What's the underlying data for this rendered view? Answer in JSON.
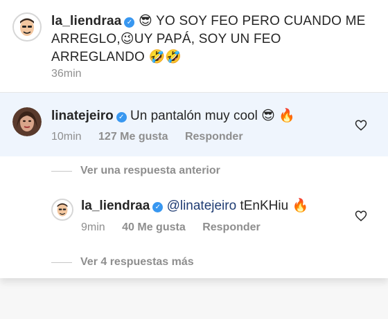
{
  "post": {
    "username": "la_liendraa",
    "caption": "😎 YO SOY FEO PERO CUANDO ME ARREGLO,😉UY PAPÁ, SOY UN FEO ARREGLANDO 🤣🤣",
    "time": "36min"
  },
  "comments": [
    {
      "username": "linatejeiro",
      "text": "Un pantalón muy cool 😎 🔥",
      "time": "10min",
      "likes": "127 Me gusta",
      "reply": "Responder"
    }
  ],
  "thread": {
    "previous_label": "Ver una respuesta anterior",
    "more_label": "Ver 4 respuestas más"
  },
  "reply": {
    "username": "la_liendraa",
    "mention": "@linatejeiro",
    "text": "tEnKHiu 🔥",
    "time": "9min",
    "likes": "40 Me gusta",
    "reply": "Responder"
  },
  "colors": {
    "verified": "#3897f0",
    "highlight": "#eff5fd",
    "muted": "#8e8e8e"
  },
  "icons": [
    "verified-badge-icon",
    "heart-icon"
  ]
}
